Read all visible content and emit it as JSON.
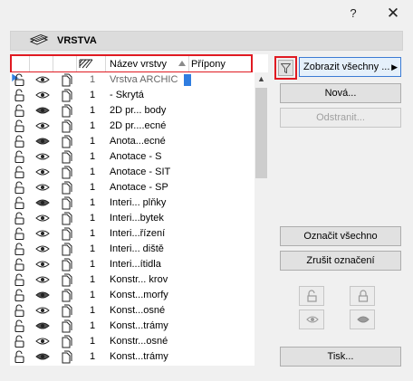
{
  "window": {
    "help_label": "?",
    "close_label": "✕"
  },
  "section": {
    "title": "VRSTVA"
  },
  "columns": {
    "name": "Název vrstvy",
    "suffix": "Přípony"
  },
  "rows": [
    {
      "num": "1",
      "name": "Vrstva ARCHIC",
      "selected": true
    },
    {
      "num": "1",
      "name": "- Skrytá"
    },
    {
      "num": "1",
      "name": "2D pr... body"
    },
    {
      "num": "1",
      "name": "2D pr....ecné"
    },
    {
      "num": "1",
      "name": "Anota...ecné"
    },
    {
      "num": "1",
      "name": "Anotace - S"
    },
    {
      "num": "1",
      "name": "Anotace - SIT"
    },
    {
      "num": "1",
      "name": "Anotace - SP"
    },
    {
      "num": "1",
      "name": "Interi... plňky"
    },
    {
      "num": "1",
      "name": "Interi...bytek"
    },
    {
      "num": "1",
      "name": "Interi...řízení"
    },
    {
      "num": "1",
      "name": "Interi... diště"
    },
    {
      "num": "1",
      "name": "Interi...ítidla"
    },
    {
      "num": "1",
      "name": "Konstr... krov"
    },
    {
      "num": "1",
      "name": "Konst...morfy"
    },
    {
      "num": "1",
      "name": "Konst...osné"
    },
    {
      "num": "1",
      "name": "Konst...trámy"
    },
    {
      "num": "1",
      "name": "Konstr...osné"
    },
    {
      "num": "1",
      "name": "Konst...trámy"
    }
  ],
  "buttons": {
    "show_all": "Zobrazit všechny ...",
    "new": "Nová...",
    "delete": "Odstranit...",
    "select_all": "Označit všechno",
    "deselect": "Zrušit označení",
    "print": "Tisk..."
  },
  "icons": {
    "lock": "padlock-open-icon",
    "visibility": "eye-icon",
    "wireframe": "layer-page-icon",
    "filter": "funnel-icon"
  },
  "colors": {
    "highlight": "#e01a22",
    "selection": "#2f7de0"
  }
}
